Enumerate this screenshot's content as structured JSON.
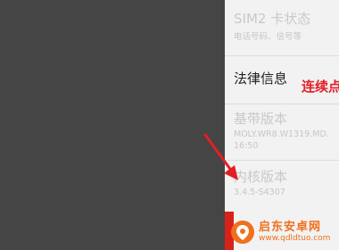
{
  "settings": {
    "sim2_status": {
      "title": "SIM2 卡状态",
      "subtitle": "电话号码、信号等"
    },
    "legal_info": {
      "title": "法律信息"
    },
    "baseband": {
      "title": "基带版本",
      "value_line1": "MOLY.WR8.W1319.MD.",
      "value_line2": "16:50"
    },
    "kernel": {
      "title": "内核版本",
      "value": "3.4.5-S4307"
    }
  },
  "annotation": {
    "text": "连续点"
  },
  "watermark": {
    "name": "启东安卓网",
    "url": "www.qdldtuo.com"
  },
  "colors": {
    "annotation": "#e41e24",
    "watermark": "#f0701e",
    "arrow": "#e41e24"
  }
}
